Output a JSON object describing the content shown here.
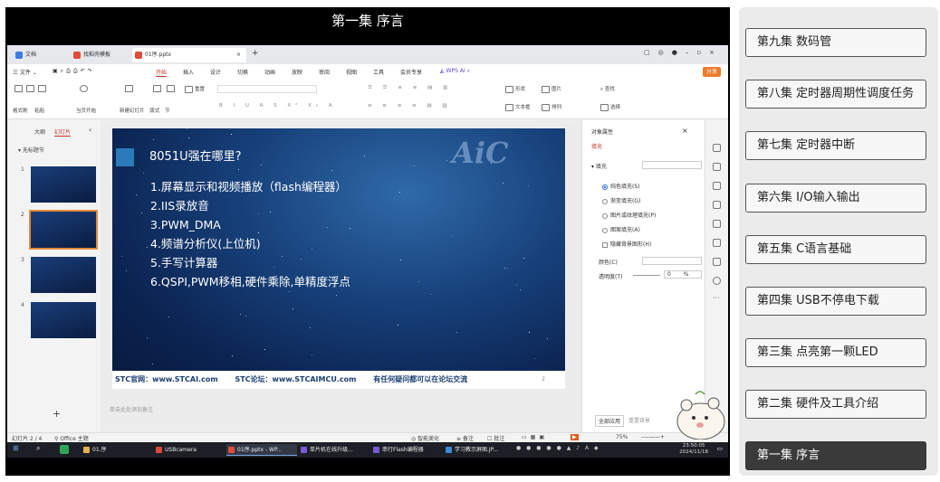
{
  "video": {
    "title": "第一集 序言",
    "tabs": [
      {
        "label": "文档",
        "color": "#3b7be6"
      },
      {
        "label": "找稻壳模板",
        "color": "#e04b3a"
      },
      {
        "label": "01序.pptx",
        "color": "#e04b3a"
      }
    ],
    "menu": {
      "file": "三 文件 ⌄",
      "items": [
        "开始",
        "插入",
        "设计",
        "切换",
        "动画",
        "放映",
        "审阅",
        "视图",
        "工具",
        "会员专享"
      ],
      "active": "开始",
      "wps_ai": "WPS AI",
      "share": "分享"
    },
    "ribbon": {
      "format_painter": "格式刷",
      "paste": "粘贴",
      "play_from_current": "当页开始",
      "new_slide": "新建幻灯片",
      "layout": "版式",
      "section": "节",
      "reset": "重置",
      "shape": "形状",
      "picture": "图片",
      "textbox": "文本框",
      "arrange": "排列",
      "find": "查找",
      "select": "选择"
    },
    "leftpanel": {
      "tab_outline": "大纲",
      "tab_slides": "幻灯片",
      "section": "无标题节",
      "slides": [
        "1",
        "2",
        "3",
        "4"
      ],
      "add": "+"
    },
    "slide": {
      "title": "8051U强在哪里?",
      "logo": "AiC",
      "items": [
        "1.屏幕显示和视频播放（flash编程器）",
        "2.IIS录放音",
        "3.PWM_DMA",
        "4.频谱分析仪(上位机)",
        "5.手写计算器",
        "6.QSPI,PWM移相,硬件乘除,单精度浮点"
      ],
      "footer": [
        "STC官网：www.STCAI.com",
        "STC论坛：www.STCAIMCU.com",
        "有任何疑问都可以在论坛交流"
      ],
      "page": "2"
    },
    "notes_placeholder": "单击此处添加备注",
    "props": {
      "title": "对象属性",
      "fill_tab": "填充",
      "fill_label": "填充",
      "options": [
        "纯色填充(S)",
        "渐变填充(G)",
        "图片或纹理填充(P)",
        "图案填充(A)",
        "隐藏背景图形(H)"
      ],
      "selected_option": "纯色填充(S)",
      "color_label": "颜色(C)",
      "transparency_label": "透明度(T)",
      "transparency_value": "0",
      "transparency_unit": "%",
      "apply_all": "全部应用",
      "reset_bg": "重置背景"
    },
    "status": {
      "slide_counter": "幻灯片 2 / 4",
      "theme": "Office 主题",
      "smart_beautify": "智能美化",
      "notes": "备注",
      "comment": "批注",
      "zoom": "75%"
    },
    "taskbar": {
      "items": [
        {
          "label": "01.序",
          "color": "#e8b34a"
        },
        {
          "label": "USBcamera",
          "color": "#d84a3a"
        },
        {
          "label": "01序.pptx - WP...",
          "color": "#e04b3a"
        },
        {
          "label": "单片机在线升级...",
          "color": "#7a5ad8"
        },
        {
          "label": "串行Flash编程器",
          "color": "#7a5ad8"
        },
        {
          "label": "学习教示屏图.JP...",
          "color": "#3a8ad8"
        }
      ],
      "time": "23:50:05",
      "date": "2024/11/18"
    }
  },
  "playlist": {
    "episodes": [
      "第九集 数码管",
      "第八集 定时器周期性调度任务",
      "第七集 定时器中断",
      "第六集 I/O输入输出",
      "第五集 C语言基础",
      "第四集 USB不停电下载",
      "第三集 点亮第一颗LED",
      "第二集 硬件及工具介绍",
      "第一集 序言"
    ],
    "current": "第一集 序言"
  }
}
